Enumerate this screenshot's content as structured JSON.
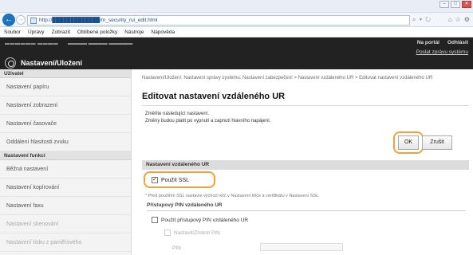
{
  "window": {
    "min": "–",
    "max": "□",
    "close": "✕"
  },
  "browser": {
    "back_icon": "back-arrow-icon",
    "address": "http://█████████████/m_security_rui_edit.html",
    "address_tools": "⌕ ▾ ↻",
    "tab_icons": [
      "⌂",
      "☆",
      "⚙"
    ]
  },
  "menu": {
    "items": [
      "Soubor",
      "Úpravy",
      "Zobrazit",
      "Oblíbené položky",
      "Nástroje",
      "Nápověda"
    ]
  },
  "topbar": {
    "blurred_left": "▬▬▬▬▬▬  ▬▬▬▬",
    "blurred_mid": "▬▬▬▬ ▬▬▬▬  ▬▬▬▬▬",
    "title": "Nastavení/Uložení",
    "portal_link": "Na portál",
    "logout_link": "Odhlásit",
    "mail_link": "Poslat zprávu systému"
  },
  "sidebar": {
    "headers": [
      "Uživatel",
      "Nastavení funkcí"
    ],
    "user_items": [
      "Nastavení papíru",
      "Nastavení zobrazení",
      "Nastavení časovače",
      "Oddálení hlasitosti zvuku"
    ],
    "function_items": [
      "Běžná nastavení",
      "Nastavení kopírování",
      "Nastavení faxu",
      "Nastavení skenování",
      "Nastavení tisku z paměťového"
    ]
  },
  "main": {
    "breadcrumb": "Nastavení/Uložení: Nastavení správy systému: Nastavení zabezpečení > Nastavení vzdáleného UR > Editovat nastavení vzdáleného UR",
    "title": "Editovat nastavení vzdáleného UR",
    "info_line1": "Změňte následující nastavení.",
    "info_line2": "Změny budou platit po vypnutí a zapnutí hlavního napájení.",
    "ok_label": "OK",
    "cancel_label": "Zrušit",
    "section_title": "Nastavení vzdáleného UR",
    "ssl_label": "Použít SSL",
    "ssl_checked": "✓",
    "ssl_note": "* Před použitím SSL nastavte výchozí klíč v Nastavení klíče a certifikátu v Nastavení SSL.",
    "pin_section": "Přístupový PIN vzdáleného UR",
    "pin_checkbox_label": "Použít přístupový PIN vzdáleného UR",
    "set_pin_label": "Nastavit/Změnit PIN",
    "pin_label": "PIN"
  },
  "colors": {
    "highlight": "#f0a13a",
    "topbar": "#222222",
    "browser_accent": "#1e73be"
  }
}
